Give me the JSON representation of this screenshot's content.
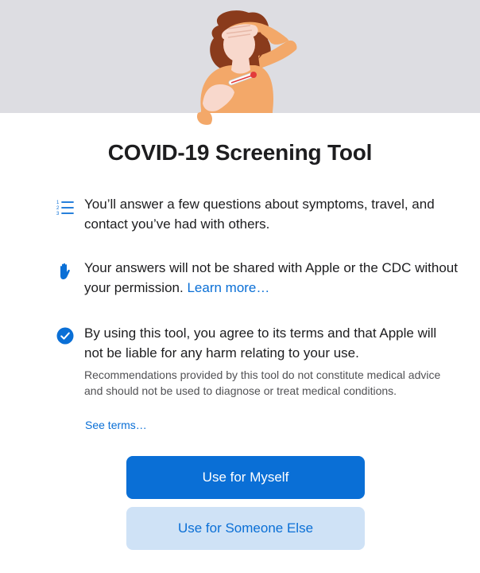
{
  "title": "COVID-19 Screening Tool",
  "items": [
    {
      "icon": "numbered-list-icon",
      "text": "You’ll answer a few questions about symptoms, travel, and contact you’ve had with others."
    },
    {
      "icon": "hand-raised-icon",
      "text": "Your answers will not be shared with Apple or the CDC without your permission.",
      "link": "Learn more…"
    },
    {
      "icon": "checkmark-circle-icon",
      "text": "By using this tool, you agree to its terms and that Apple will not be liable for any harm relating to your use."
    }
  ],
  "fine_print": "Recommendations provided by this tool do not constitute medical advice and should not be used to diagnose or treat medical conditions.",
  "see_terms": "See terms…",
  "buttons": {
    "primary": "Use for Myself",
    "secondary": "Use for Someone Else"
  },
  "colors": {
    "accent": "#0a6fd6",
    "hero_background": "#dddde2",
    "secondary_button": "#cfe2f6"
  }
}
